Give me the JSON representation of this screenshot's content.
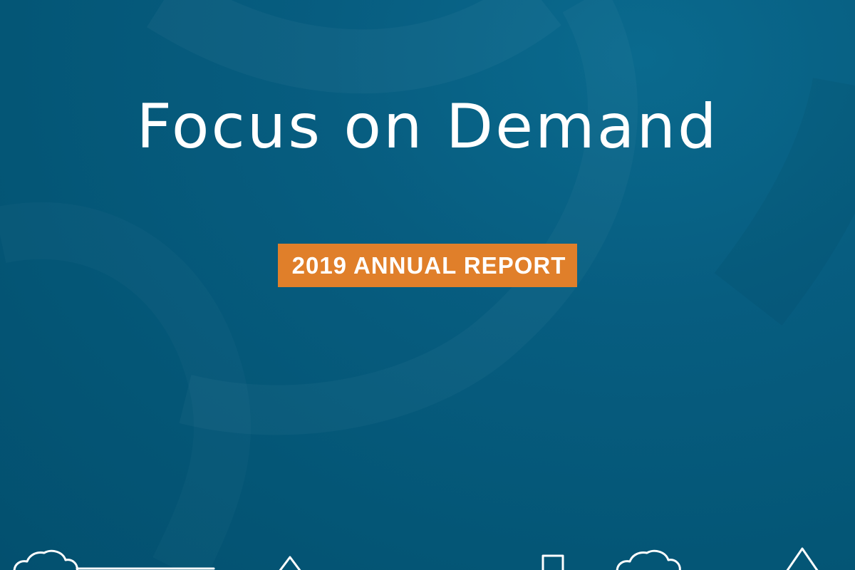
{
  "cover": {
    "title": "Focus on Demand",
    "badge": "2019 ANNUAL REPORT"
  },
  "colors": {
    "background": "#045676",
    "badge": "#e07f2a",
    "text": "#ffffff"
  },
  "icons": [
    "cloud-icon",
    "tree-icon",
    "building-icon",
    "cloud-icon",
    "tree-icon"
  ]
}
